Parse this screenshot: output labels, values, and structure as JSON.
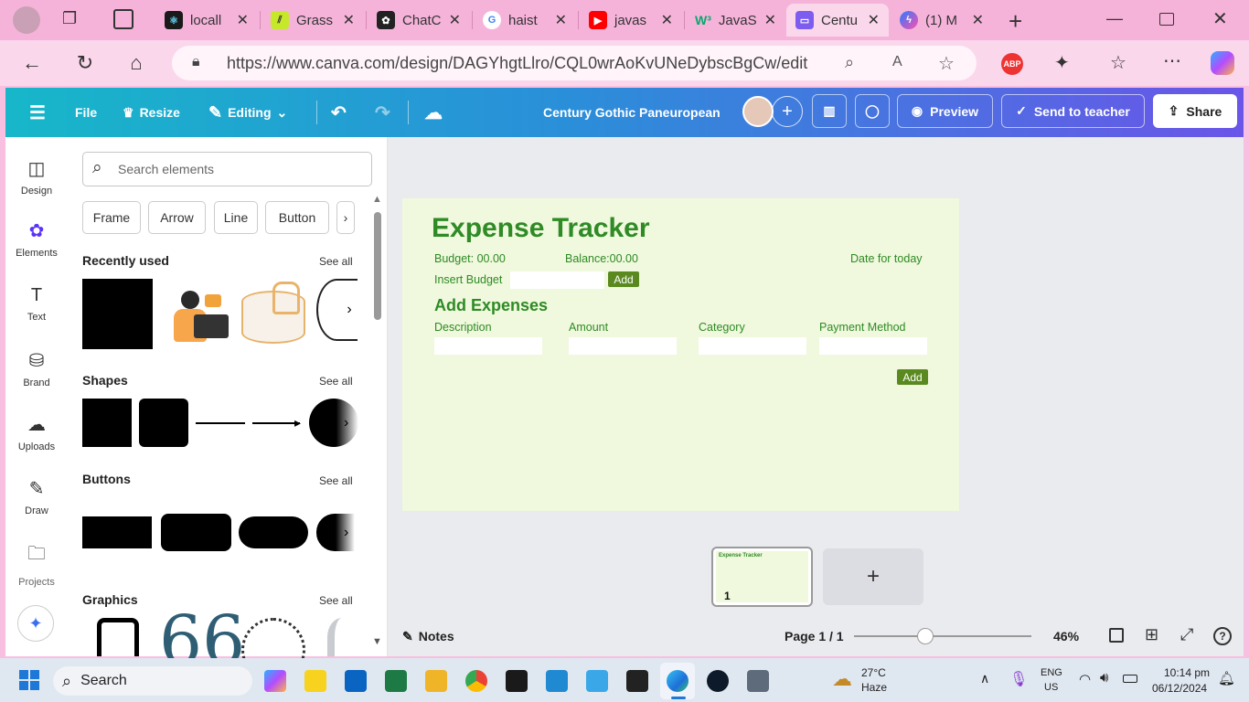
{
  "browser": {
    "tabs": [
      {
        "label": "locall",
        "icon": "react-icon"
      },
      {
        "label": "Grass",
        "icon": "grass-icon"
      },
      {
        "label": "ChatC",
        "icon": "chatgpt-icon"
      },
      {
        "label": "haist",
        "icon": "google-icon"
      },
      {
        "label": "javas",
        "icon": "youtube-icon"
      },
      {
        "label": "JavaS",
        "icon": "w3schools-icon"
      },
      {
        "label": "Centu",
        "icon": "canva-icon"
      },
      {
        "label": "(1) M",
        "icon": "messenger-icon"
      }
    ],
    "url": "https://www.canva.com/design/DAGYhgtLlro/CQL0wrAoKvUNeDybscBgCw/edit",
    "abp_label": "ABP"
  },
  "canva_toolbar": {
    "file": "File",
    "resize": "Resize",
    "editing": "Editing",
    "title": "Century Gothic Paneuropean",
    "preview": "Preview",
    "send": "Send to teacher",
    "share": "Share"
  },
  "rail": [
    {
      "label": "Design"
    },
    {
      "label": "Elements"
    },
    {
      "label": "Text"
    },
    {
      "label": "Brand"
    },
    {
      "label": "Uploads"
    },
    {
      "label": "Draw"
    },
    {
      "label": "Projects"
    }
  ],
  "panel": {
    "search_placeholder": "Search elements",
    "chips": [
      "Frame",
      "Arrow",
      "Line",
      "Button"
    ],
    "recently_used": "Recently used",
    "shapes": "Shapes",
    "buttons": "Buttons",
    "graphics": "Graphics",
    "see_all": "See all"
  },
  "design": {
    "title": "Expense Tracker",
    "budget": "Budget: 00.00",
    "balance": "Balance:00.00",
    "date": "Date for today",
    "insert_budget": "Insert Budget",
    "add": "Add",
    "add_expenses": "Add Expenses",
    "cols": [
      "Description",
      "Amount",
      "Category",
      "Payment Method"
    ],
    "accent": "#2e8b25",
    "bg": "#f0f8dd"
  },
  "bottom": {
    "notes": "Notes",
    "page": "Page 1 / 1",
    "zoom": "46%",
    "thumb_title": "Expense Tracker",
    "thumb_num": "1"
  },
  "taskbar": {
    "search": "Search",
    "weather_temp": "27°C",
    "weather_desc": "Haze",
    "lang1": "ENG",
    "lang2": "US",
    "time": "10:14 pm",
    "date": "06/12/2024"
  }
}
